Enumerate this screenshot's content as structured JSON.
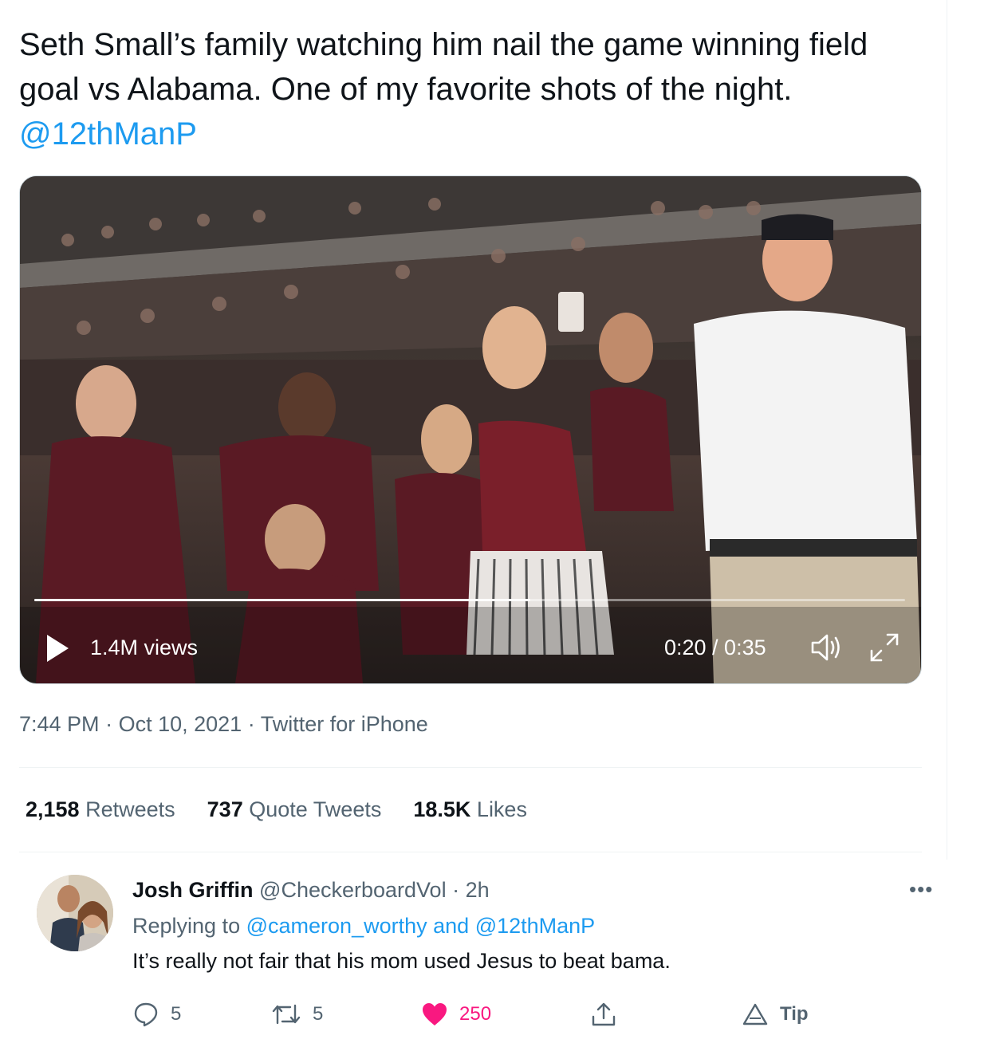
{
  "tweet": {
    "text": "Seth Small’s family watching him nail the game winning field goal vs Alabama. One of my favorite shots of the night.",
    "mention": "@12thManP"
  },
  "video": {
    "views": "1.4M views",
    "time": "0:20 / 0:35",
    "progress_fraction": 0.57,
    "icons": [
      "play-icon",
      "volume-icon",
      "fullscreen-icon"
    ]
  },
  "meta": {
    "time": "7:44 PM",
    "sep": "·",
    "date": "Oct 10, 2021",
    "source": "Twitter for iPhone"
  },
  "stats": {
    "retweets_count": "2,158",
    "retweets_label": "Retweets",
    "quotes_count": "737",
    "quotes_label": "Quote Tweets",
    "likes_count": "18.5K",
    "likes_label": "Likes"
  },
  "reply": {
    "name": "Josh Griffin",
    "handle": "@CheckerboardVol",
    "sep": "·",
    "age": "2h",
    "more": "•••",
    "replying_prefix": "Replying to",
    "replying_user1": "@cameron_worthy",
    "replying_and": "and",
    "replying_user2": "@12thManP",
    "text": "It’s really not fair that his mom used Jesus to beat bama.",
    "actions": {
      "replies": "5",
      "retweets": "5",
      "likes": "250",
      "tip": "Tip"
    }
  },
  "colors": {
    "accent": "#1d9bf0",
    "like": "#f91880",
    "secondary_text": "#536471"
  }
}
